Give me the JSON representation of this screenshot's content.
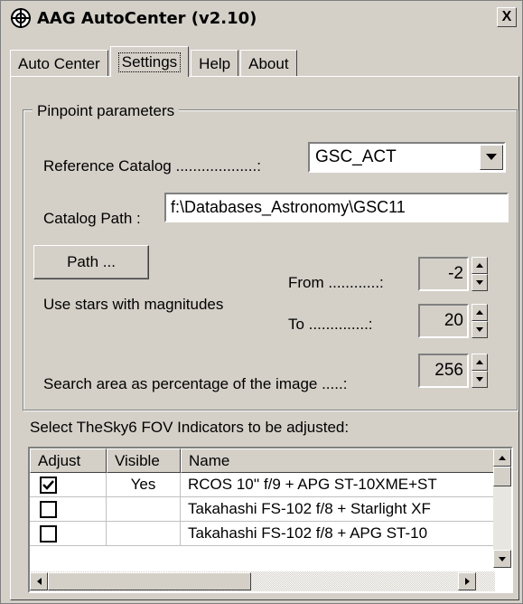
{
  "window": {
    "title": "AAG AutoCenter (v2.10)",
    "close_label": "X"
  },
  "tabs": [
    {
      "label": "Auto Center",
      "active": false
    },
    {
      "label": "Settings",
      "active": true
    },
    {
      "label": "Help",
      "active": false
    },
    {
      "label": "About",
      "active": false
    }
  ],
  "pinpoint": {
    "group_label": "Pinpoint parameters",
    "reference_catalog_label": "Reference Catalog ...................:",
    "reference_catalog_value": "GSC_ACT",
    "catalog_path_label": "Catalog Path :",
    "catalog_path_value": "f:\\Databases_Astronomy\\GSC11",
    "path_button_label": "Path ...",
    "magnitudes_label": "Use stars with magnitudes",
    "from_label": "From ............:",
    "from_value": "-2",
    "to_label": "To ..............:",
    "to_value": "20",
    "search_area_label": "Search area as percentage of the image .....:",
    "search_area_value": "256"
  },
  "fov": {
    "section_label": "Select TheSky6 FOV Indicators to be adjusted:",
    "columns": [
      "Adjust",
      "Visible",
      "Name"
    ],
    "rows": [
      {
        "checked": true,
        "visible": "Yes",
        "name": "RCOS 10'' f/9 + APG ST-10XME+ST"
      },
      {
        "checked": false,
        "visible": "",
        "name": "Takahashi FS-102 f/8  + Starlight XF"
      },
      {
        "checked": false,
        "visible": "",
        "name": "Takahashi FS-102 f/8  + APG ST-10"
      }
    ]
  },
  "icons": {
    "app": "crosshair-globe-icon",
    "dropdown": "chevron-down-icon",
    "spin_up": "arrow-up-icon",
    "spin_down": "arrow-down-icon",
    "checkbox": "checkmark-icon"
  }
}
